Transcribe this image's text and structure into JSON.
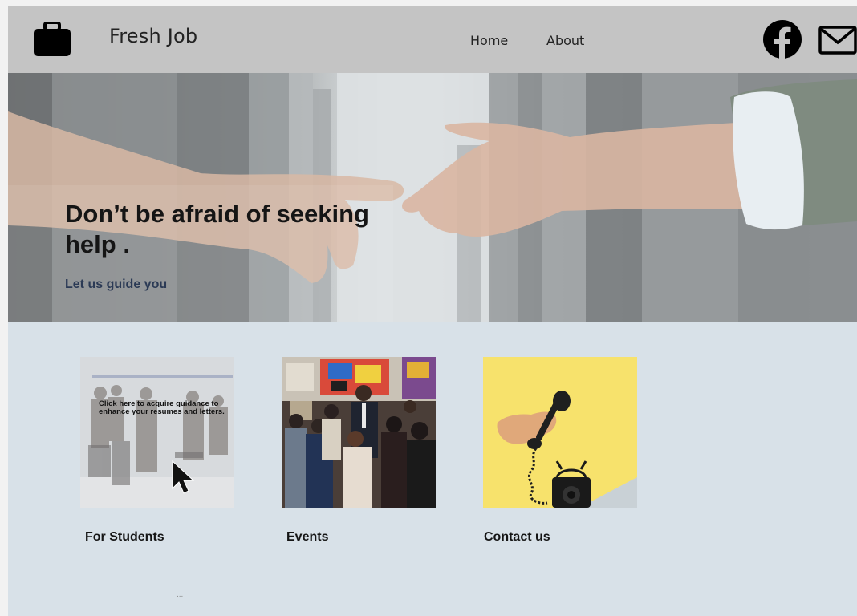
{
  "header": {
    "brand": "Fresh Job",
    "nav": {
      "home": "Home",
      "about": "About"
    },
    "icons": {
      "logo": "briefcase-icon",
      "facebook": "facebook-icon",
      "mail": "mail-icon"
    }
  },
  "hero": {
    "title": "Don’t be afraid of seeking help .",
    "subtitle": "Let us guide you"
  },
  "cards": [
    {
      "label": "For Students",
      "overlay": "Click here to acquire guidance to enhance your resumes and letters."
    },
    {
      "label": "Events"
    },
    {
      "label": "Contact us"
    }
  ],
  "footer": {
    "dots": "..."
  },
  "colors": {
    "header_bg": "#c4c4c4",
    "page_bg": "#d8e1e8",
    "subtitle": "#2b3a55",
    "contact_card_yellow": "#f7e16a"
  }
}
